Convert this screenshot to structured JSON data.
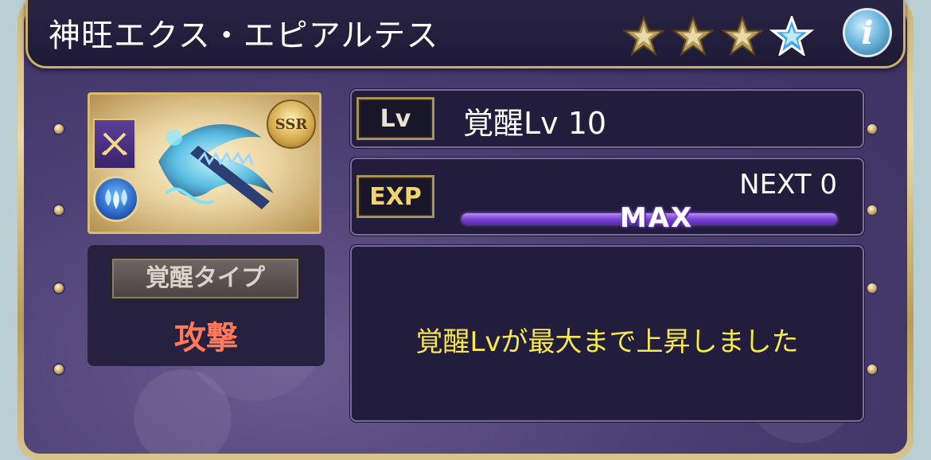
{
  "header": {
    "title": "神旺エクス・エピアルテス",
    "rarity_stars": 4,
    "info_label": "i"
  },
  "portrait": {
    "rarity_badge": "SSR",
    "class_icon": "crossed-swords-icon",
    "element_icon": "water-icon"
  },
  "awakening_type": {
    "label": "覚醒タイプ",
    "value": "攻撃"
  },
  "level": {
    "tag": "Lv",
    "text": "覚醒Lv 10"
  },
  "exp": {
    "tag": "EXP",
    "next_text": "NEXT 0",
    "bar_label": "MAX",
    "fill_fraction": 1.0
  },
  "message": "覚醒Lvが最大まで上昇しました",
  "colors": {
    "title_bar": "#1e1a35",
    "panel": "#4a3e72",
    "frame_gold": "#c9ad6a",
    "type_value": "#ff7a5a",
    "message": "#f6e94d",
    "exp_bar": "#7a46d6"
  }
}
